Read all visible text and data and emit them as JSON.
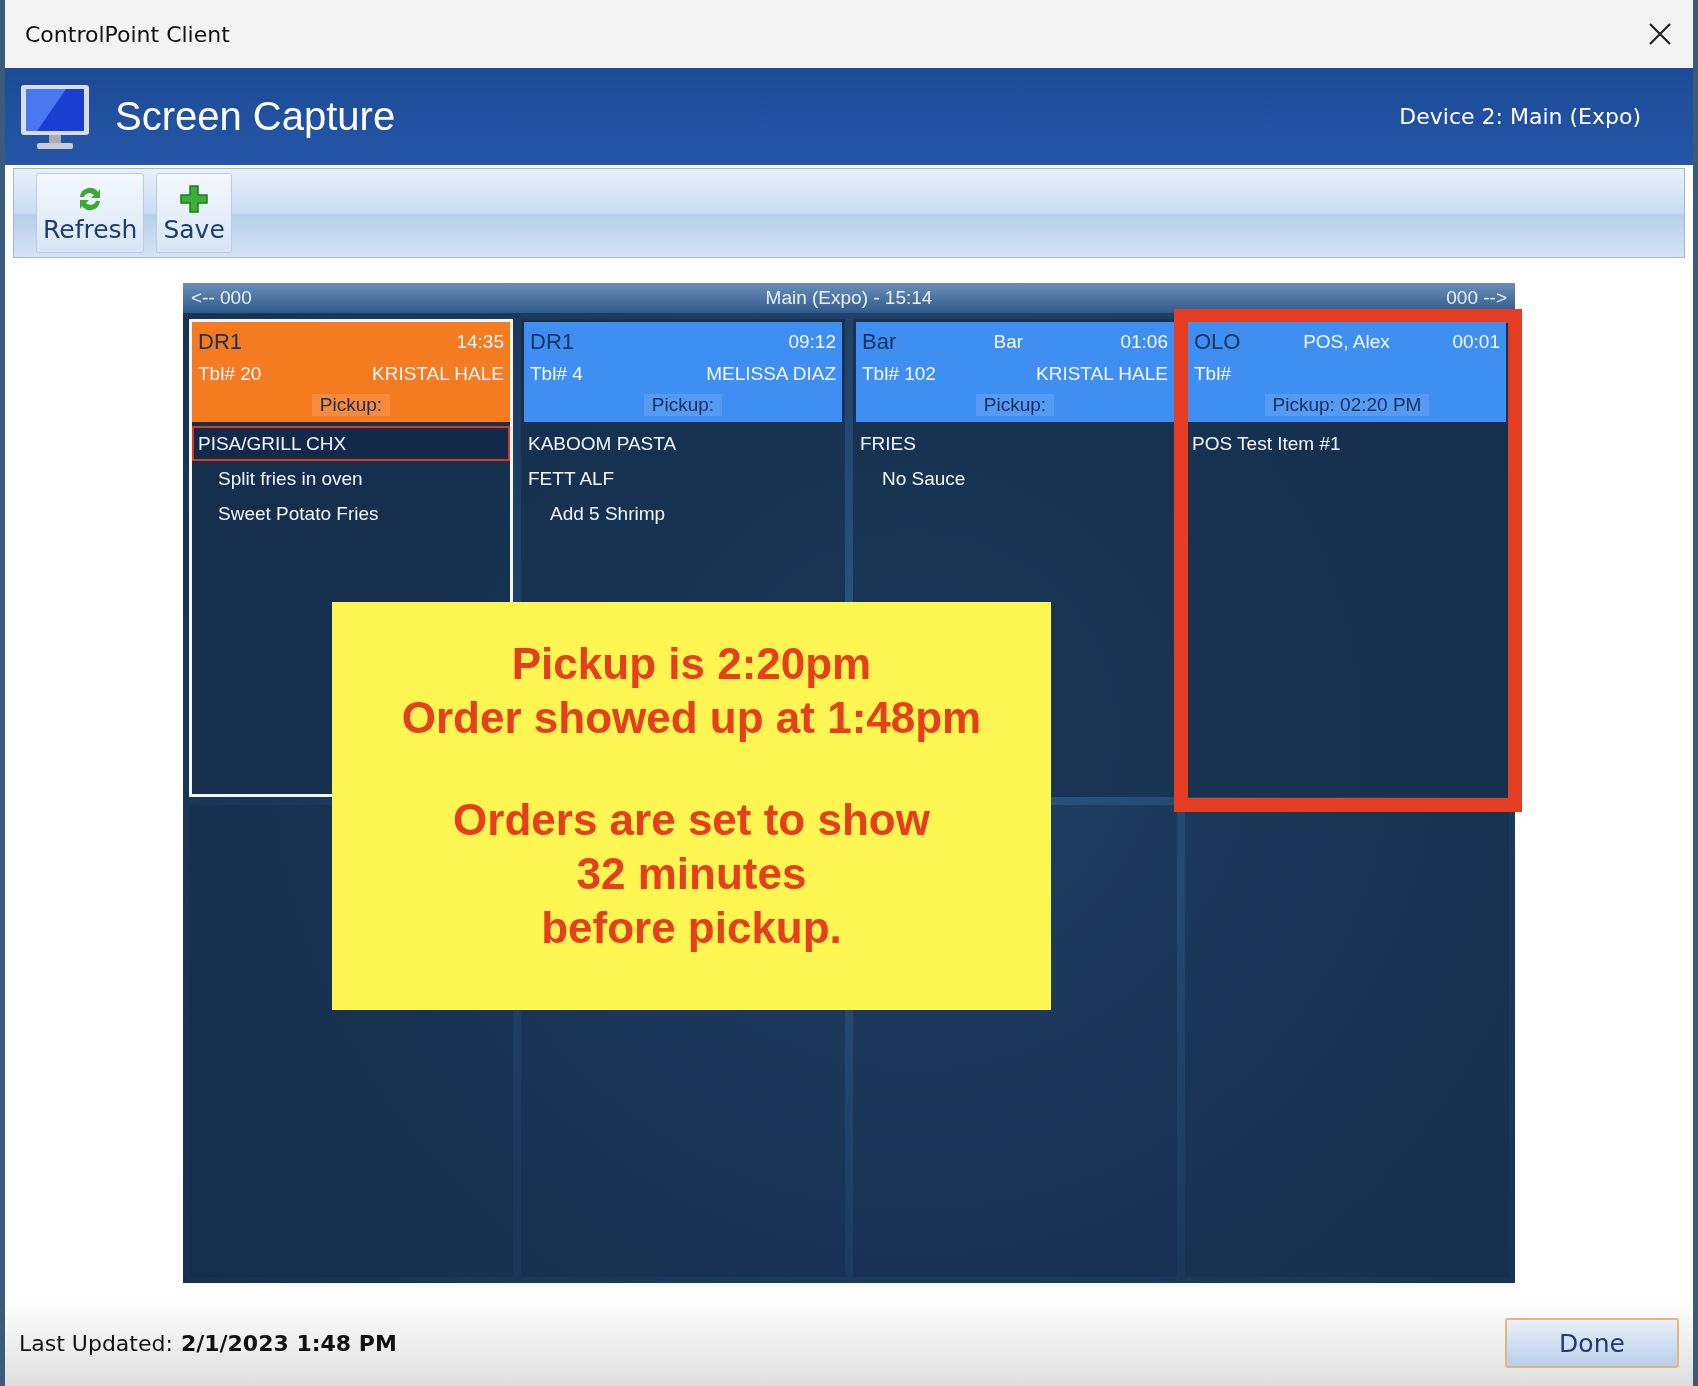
{
  "window": {
    "title": "ControlPoint Client"
  },
  "header": {
    "title": "Screen Capture",
    "device": "Device 2: Main (Expo)"
  },
  "toolbar": {
    "buttons": [
      {
        "label": "Refresh",
        "kind": "refresh"
      },
      {
        "label": "Save",
        "kind": "save"
      }
    ]
  },
  "screen": {
    "nav_prev": "<-- 000",
    "title": "Main (Expo) - 15:14",
    "nav_next": "000 -->",
    "tickets": [
      {
        "source": "DR1",
        "elapsed": "14:35",
        "table": "Tbl# 20",
        "name": "KRISTAL HALE",
        "pickup": "Pickup:",
        "color": "#f47b20",
        "selected": true,
        "highlighted": false,
        "items": [
          {
            "text": "PISA/GRILL CHX",
            "kind": "item",
            "selected": true
          },
          {
            "text": "Split fries in oven",
            "kind": "modifier",
            "selected": false
          },
          {
            "text": "Sweet Potato Fries",
            "kind": "modifier",
            "selected": false
          }
        ]
      },
      {
        "source": "DR1",
        "elapsed": "09:12",
        "table": "Tbl# 4",
        "name": "MELISSA DIAZ",
        "pickup": "Pickup:",
        "color": "#3f8ef2",
        "selected": false,
        "highlighted": false,
        "items": [
          {
            "text": "KABOOM PASTA",
            "kind": "item",
            "selected": false
          },
          {
            "text": "FETT ALF",
            "kind": "item",
            "selected": false
          },
          {
            "text": "Add 5 Shrimp",
            "kind": "modifier",
            "selected": false
          }
        ]
      },
      {
        "source": "Bar",
        "server": "Bar",
        "elapsed": "01:06",
        "table": "Tbl# 102",
        "name": "KRISTAL HALE",
        "pickup": "Pickup:",
        "color": "#3f8ef2",
        "selected": false,
        "highlighted": false,
        "items": [
          {
            "text": "FRIES",
            "kind": "item",
            "selected": false
          },
          {
            "text": "No Sauce",
            "kind": "modifier",
            "selected": false
          }
        ]
      },
      {
        "source": "OLO",
        "server": "POS, Alex",
        "elapsed": "00:01",
        "table": "Tbl#",
        "pickup": "Pickup: 02:20 PM",
        "color": "#3f8ef2",
        "selected": false,
        "highlighted": true,
        "items": [
          {
            "text": "POS Test Item #1",
            "kind": "item",
            "selected": false
          }
        ]
      }
    ]
  },
  "annotation": {
    "paragraphs": [
      [
        "Pickup is 2:20pm",
        "Order showed up at 1:48pm"
      ],
      [
        "Orders are set to show",
        "32 minutes",
        "before pickup."
      ]
    ]
  },
  "footer": {
    "label": "Last Updated:",
    "value": "2/1/2023 1:48 PM",
    "done": "Done"
  }
}
